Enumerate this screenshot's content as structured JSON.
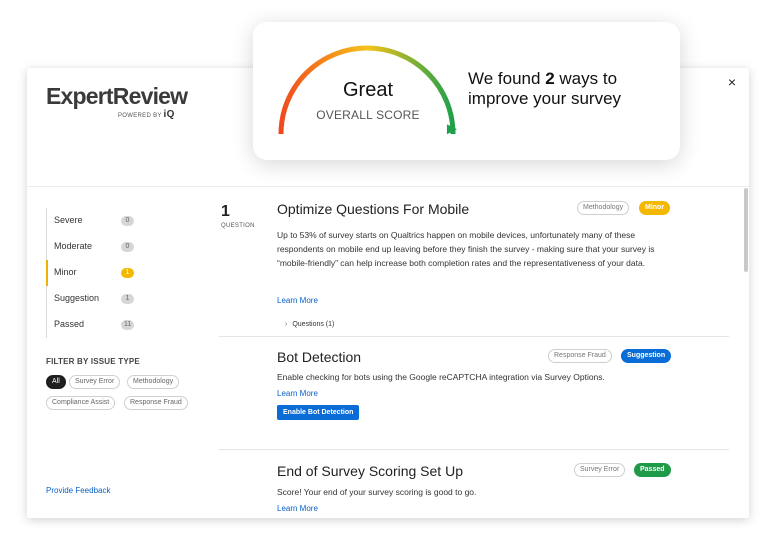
{
  "brand": {
    "name": "ExpertReview",
    "powered_by": "POWERED BY",
    "iq": "iQ"
  },
  "header": {
    "close": "×"
  },
  "score": {
    "rating": "Great",
    "label": "OVERALL SCORE",
    "level": 0.93,
    "found_prefix": "We found",
    "found_count": "2",
    "found_suffix": "ways to improve your survey"
  },
  "severity_filters": [
    {
      "label": "Severe",
      "count": "0"
    },
    {
      "label": "Moderate",
      "count": "0"
    },
    {
      "label": "Minor",
      "count": "1"
    },
    {
      "label": "Suggestion",
      "count": "1"
    },
    {
      "label": "Passed",
      "count": "11"
    }
  ],
  "issue_type_filter": {
    "title": "FILTER BY ISSUE TYPE",
    "chips": [
      "All",
      "Survey Error",
      "Methodology",
      "Compliance Assist",
      "Response Fraud"
    ]
  },
  "feedback": "Provide Feedback",
  "issues": [
    {
      "count": "1",
      "count_label": "QUESTION",
      "title": "Optimize Questions For Mobile",
      "type_tag": "Methodology",
      "severity_tag": "Minor",
      "body": "Up to 53% of survey starts on Qualtrics happen on mobile devices, unfortunately many of these respondents on mobile end up leaving before they finish the survey - making sure that your survey is “mobile-friendly” can help increase both completion rates and the representativeness of your data.",
      "learn_more": "Learn More",
      "questions_toggle": "Questions (1)"
    },
    {
      "title": "Bot Detection",
      "type_tag": "Response Fraud",
      "severity_tag": "Suggestion",
      "body": "Enable checking for bots using the Google reCAPTCHA integration via Survey Options.",
      "learn_more": "Learn More",
      "action": "Enable Bot Detection"
    },
    {
      "title": "End of Survey Scoring Set Up",
      "type_tag": "Survey Error",
      "severity_tag": "Passed",
      "body": "Score! Your end of your survey scoring is good to go.",
      "learn_more": "Learn More"
    }
  ],
  "colors": {
    "link": "#0a60c8",
    "minor": "#f5b800",
    "suggestion": "#0a6cd6",
    "passed": "#1f9a48",
    "gauge_start": "#f04a1e",
    "gauge_mid": "#f6c21a",
    "gauge_end": "#1fa04a"
  }
}
